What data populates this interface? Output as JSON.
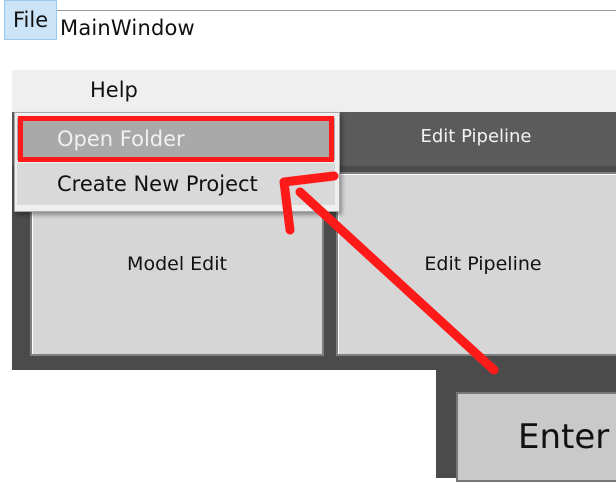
{
  "window": {
    "title": "MainWindow",
    "icon": "app-window-icon"
  },
  "menubar": {
    "items": [
      {
        "label": "File",
        "active": true
      },
      {
        "label": "Help",
        "active": false
      }
    ]
  },
  "file_menu": {
    "items": [
      {
        "label": "Open Folder",
        "state": "highlighted"
      },
      {
        "label": "Create New Project",
        "state": "normal"
      }
    ]
  },
  "central": {
    "tab_label": "Edit Pipeline",
    "buttons": [
      {
        "label": "Model Edit"
      },
      {
        "label": "Edit Pipeline"
      }
    ],
    "enter_button": "Enter"
  },
  "annotation": {
    "highlight_color": "#ff1a1a",
    "arrow_color": "#ff1a1a",
    "target": "Open Folder"
  }
}
